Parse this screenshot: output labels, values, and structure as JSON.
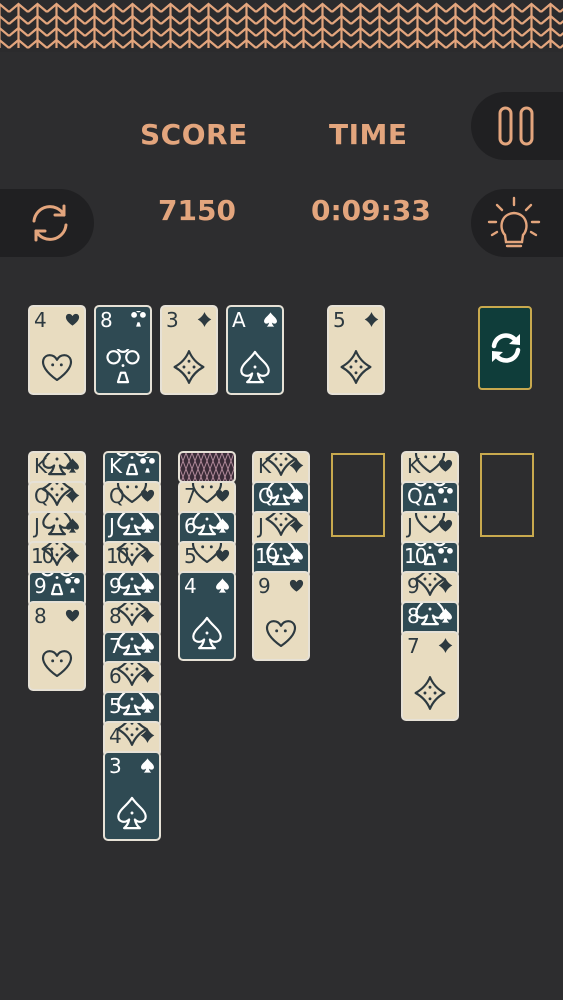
{
  "header": {
    "score_label": "SCORE",
    "time_label": "TIME",
    "score_value": "7150",
    "time_value": "0:09:33"
  },
  "colors": {
    "background": "#2d2d2f",
    "accent": "#e3a57d",
    "card_light": "#e8dcc0",
    "card_dark": "#2f4a53",
    "slot_outline": "#c8a94e",
    "stock_card": "#0f3d3a"
  },
  "icons": {
    "pause": "pause-icon",
    "undo": "refresh-cycle-icon",
    "hint": "lightbulb-icon",
    "stock": "recycle-stock-icon"
  },
  "foundations": [
    {
      "rank": "4",
      "suit": "heart",
      "style": "light"
    },
    {
      "rank": "8",
      "suit": "club",
      "style": "dark"
    },
    {
      "rank": "3",
      "suit": "diamond",
      "style": "light"
    },
    {
      "rank": "A",
      "suit": "spade",
      "style": "dark"
    }
  ],
  "waste": {
    "rank": "5",
    "suit": "diamond",
    "style": "light"
  },
  "tableau": [
    {
      "facedown": 0,
      "cards": [
        {
          "rank": "K",
          "suit": "spade",
          "style": "light"
        },
        {
          "rank": "Q",
          "suit": "diamond",
          "style": "light"
        },
        {
          "rank": "J",
          "suit": "spade",
          "style": "light"
        },
        {
          "rank": "10",
          "suit": "diamond",
          "style": "light"
        },
        {
          "rank": "9",
          "suit": "club",
          "style": "dark"
        },
        {
          "rank": "8",
          "suit": "heart",
          "style": "light"
        }
      ]
    },
    {
      "facedown": 0,
      "cards": [
        {
          "rank": "K",
          "suit": "club",
          "style": "dark"
        },
        {
          "rank": "Q",
          "suit": "heart",
          "style": "light"
        },
        {
          "rank": "J",
          "suit": "spade",
          "style": "dark"
        },
        {
          "rank": "10",
          "suit": "diamond",
          "style": "light"
        },
        {
          "rank": "9",
          "suit": "spade",
          "style": "dark"
        },
        {
          "rank": "8",
          "suit": "diamond",
          "style": "light"
        },
        {
          "rank": "7",
          "suit": "spade",
          "style": "dark"
        },
        {
          "rank": "6",
          "suit": "diamond",
          "style": "light"
        },
        {
          "rank": "5",
          "suit": "spade",
          "style": "dark"
        },
        {
          "rank": "4",
          "suit": "diamond",
          "style": "light"
        },
        {
          "rank": "3",
          "suit": "spade",
          "style": "dark"
        }
      ]
    },
    {
      "facedown": 1,
      "cards": [
        {
          "rank": "7",
          "suit": "heart",
          "style": "light"
        },
        {
          "rank": "6",
          "suit": "spade",
          "style": "dark"
        },
        {
          "rank": "5",
          "suit": "heart",
          "style": "light"
        },
        {
          "rank": "4",
          "suit": "spade",
          "style": "dark"
        }
      ]
    },
    {
      "facedown": 0,
      "cards": [
        {
          "rank": "K",
          "suit": "diamond",
          "style": "light"
        },
        {
          "rank": "Q",
          "suit": "spade",
          "style": "dark"
        },
        {
          "rank": "J",
          "suit": "diamond",
          "style": "light"
        },
        {
          "rank": "10",
          "suit": "spade",
          "style": "dark"
        },
        {
          "rank": "9",
          "suit": "heart",
          "style": "light"
        }
      ]
    },
    {
      "facedown": 0,
      "cards": []
    },
    {
      "facedown": 0,
      "cards": [
        {
          "rank": "K",
          "suit": "heart",
          "style": "light"
        },
        {
          "rank": "Q",
          "suit": "club",
          "style": "dark"
        },
        {
          "rank": "J",
          "suit": "heart",
          "style": "light"
        },
        {
          "rank": "10",
          "suit": "club",
          "style": "dark"
        },
        {
          "rank": "9",
          "suit": "diamond",
          "style": "light"
        },
        {
          "rank": "8",
          "suit": "spade",
          "style": "dark"
        },
        {
          "rank": "7",
          "suit": "diamond",
          "style": "light"
        }
      ]
    },
    {
      "facedown": 0,
      "cards": []
    }
  ]
}
